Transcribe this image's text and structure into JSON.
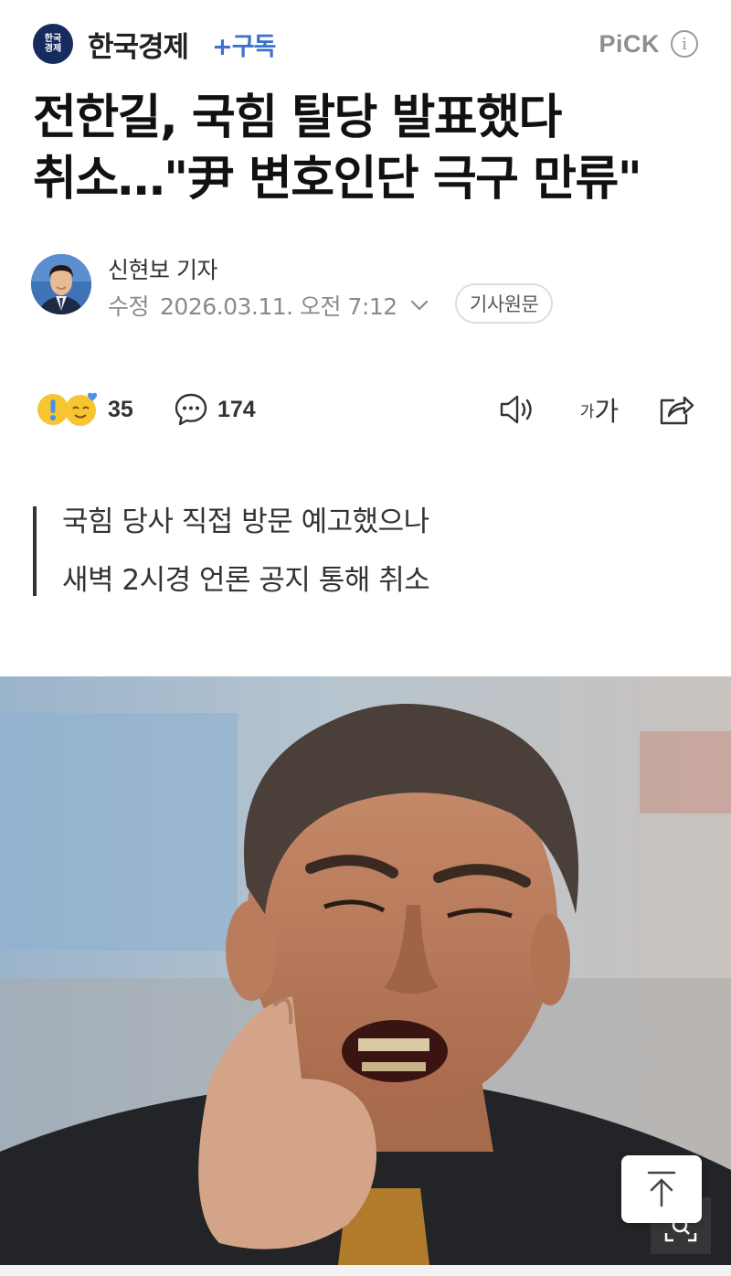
{
  "header": {
    "logo_text_line1": "한국",
    "logo_text_line2": "경제",
    "press_name": "한국경제",
    "subscribe_label": "+구독",
    "pick_label": "PiCK",
    "info_label": "i"
  },
  "article": {
    "title": "전한길, 국힘 탈당 발표했다 취소…\"尹 변호인단 극구 만류\"",
    "reporter": "신현보 기자",
    "date_prefix": "수정",
    "date_value": "2026.03.11. 오전 7:12",
    "original_button": "기사원문",
    "summary": [
      "국힘 당사 직접 방문 예고했으나",
      "새벽 2시경 언론 공지 통해 취소"
    ]
  },
  "toolbar": {
    "reactions_count": "35",
    "comments_count": "174",
    "font_size_small": "가",
    "font_size_big": "가",
    "icons": [
      "reaction-emoji-icon",
      "comment-icon",
      "speaker-icon",
      "font-size-icon",
      "share-icon"
    ]
  },
  "colors": {
    "brand_navy": "#172b5e",
    "subscribe_blue": "#3d6fcc",
    "emoji_yellow": "#f7c531",
    "heart_blue": "#4a8ef0"
  }
}
